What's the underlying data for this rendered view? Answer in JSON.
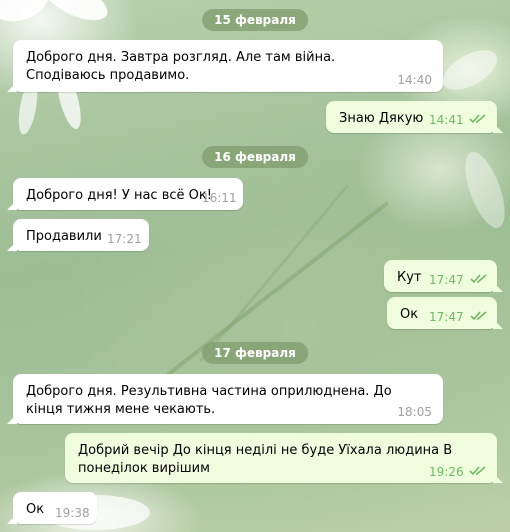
{
  "dates": [
    "15 февраля",
    "16 февраля",
    "17 февраля"
  ],
  "messages": [
    {
      "dir": "in",
      "text": "Доброго дня. Завтра розгляд. Але там війна. Сподіваюсь продавимо.",
      "time": "14:40"
    },
    {
      "dir": "out",
      "text": "Знаю Дякую",
      "time": "14:41"
    },
    {
      "dir": "in",
      "text": "Доброго дня! У нас всё Ок!",
      "time": "16:11"
    },
    {
      "dir": "in",
      "text": "Продавили",
      "time": "17:21"
    },
    {
      "dir": "out",
      "text": "Кут",
      "time": "17:47"
    },
    {
      "dir": "out",
      "text": "Ок",
      "time": "17:47"
    },
    {
      "dir": "in",
      "text": "Доброго дня. Результивна частина оприлюднена. До кінця тижня мене чекають.",
      "time": "18:05"
    },
    {
      "dir": "out",
      "text": "Добрий вечір До кінця неділі не буде Уїхала людина В понеділок вирішим",
      "time": "19:26"
    },
    {
      "dir": "in",
      "text": "Ок",
      "time": "19:38"
    }
  ],
  "colors": {
    "incoming": "#ffffff",
    "outgoing": "#effdde",
    "read_check": "#6dbb60",
    "date_pill": "#809e6e"
  },
  "icons": {
    "read_receipt": "double-check-icon"
  }
}
